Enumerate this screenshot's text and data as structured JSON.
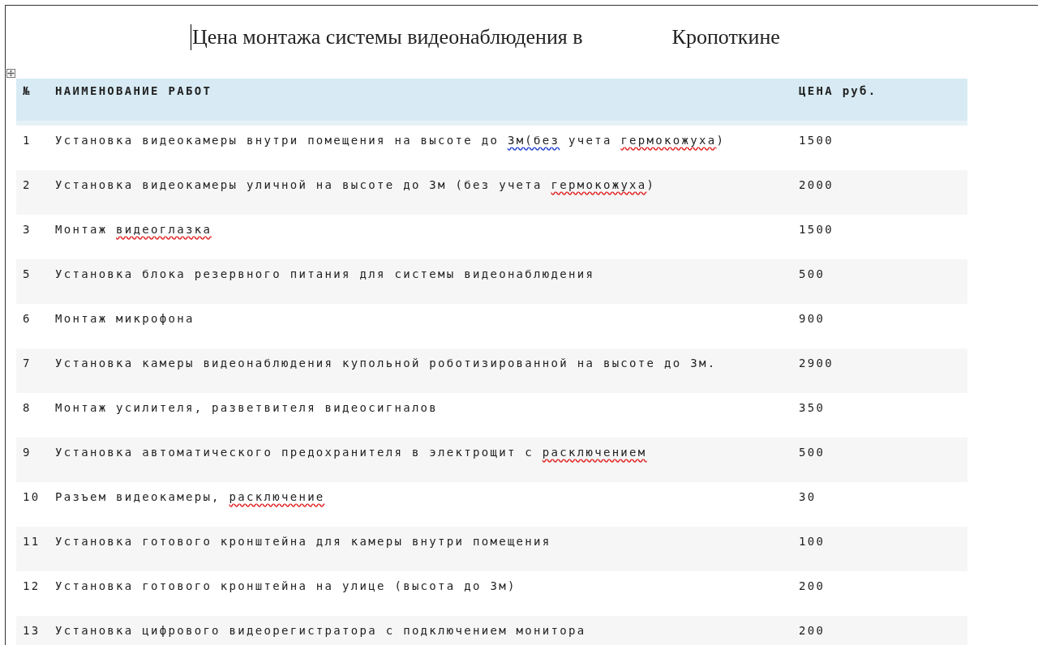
{
  "title": {
    "parts": [
      "Цена монтажа системы видеонаблюдения в",
      "Кропоткине"
    ]
  },
  "table": {
    "columns": [
      "№",
      "НАИМЕНОВАНИЕ РАБОТ",
      "ЦЕНА руб."
    ],
    "rows": [
      {
        "num": "1",
        "name": [
          {
            "text": "Установка видеокамеры внутри помещения на высоте до ",
            "kind": "plain"
          },
          {
            "text": "3м(без",
            "kind": "grammar"
          },
          {
            "text": " учета ",
            "kind": "plain"
          },
          {
            "text": "гермокожуха",
            "kind": "spelling"
          },
          {
            "text": ")",
            "kind": "plain"
          }
        ],
        "price": "1500"
      },
      {
        "num": "2",
        "name": [
          {
            "text": "Установка видеокамеры уличной на высоте до 3м (без учета ",
            "kind": "plain"
          },
          {
            "text": "гермокожуха",
            "kind": "spelling"
          },
          {
            "text": ")",
            "kind": "plain"
          }
        ],
        "price": "2000"
      },
      {
        "num": "3",
        "name": [
          {
            "text": "Монтаж ",
            "kind": "plain"
          },
          {
            "text": "видеоглазка",
            "kind": "spelling"
          }
        ],
        "price": "1500"
      },
      {
        "num": "5",
        "name": [
          {
            "text": "Установка блока резервного питания для системы видеонаблюдения",
            "kind": "plain"
          }
        ],
        "price": "500"
      },
      {
        "num": "6",
        "name": [
          {
            "text": "Монтаж микрофона",
            "kind": "plain"
          }
        ],
        "price": "900"
      },
      {
        "num": "7",
        "name": [
          {
            "text": "Установка камеры видеонаблюдения купольной роботизированной на высоте до 3м.",
            "kind": "plain"
          }
        ],
        "price": "2900"
      },
      {
        "num": "8",
        "name": [
          {
            "text": "Монтаж усилителя, разветвителя видеосигналов",
            "kind": "plain"
          }
        ],
        "price": "350"
      },
      {
        "num": "9",
        "name": [
          {
            "text": "Установка автоматического предохранителя в электрощит с ",
            "kind": "plain"
          },
          {
            "text": "расключением",
            "kind": "spelling"
          }
        ],
        "price": "500"
      },
      {
        "num": "10",
        "name": [
          {
            "text": "Разъем видеокамеры, ",
            "kind": "plain"
          },
          {
            "text": "расключение",
            "kind": "spelling"
          }
        ],
        "price": "30"
      },
      {
        "num": "11",
        "name": [
          {
            "text": "Установка готового кронштейна для камеры внутри помещения",
            "kind": "plain"
          }
        ],
        "price": "100"
      },
      {
        "num": "12",
        "name": [
          {
            "text": "Установка готового кронштейна на улице (высота до 3м)",
            "kind": "plain"
          }
        ],
        "price": "200"
      },
      {
        "num": "13",
        "name": [
          {
            "text": "Установка цифрового видеорегистратора с подключением монитора",
            "kind": "plain"
          }
        ],
        "price": "200"
      }
    ]
  }
}
